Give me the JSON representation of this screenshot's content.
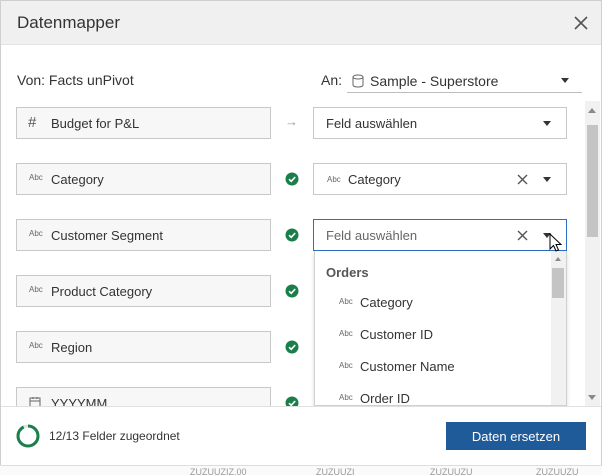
{
  "dialog": {
    "title": "Datenmapper",
    "from_label": "Von: Facts unPivot",
    "to_label": "An:",
    "to_source": "Sample - Superstore"
  },
  "rows": [
    {
      "source": "Budget for P&L",
      "source_type": "number",
      "status": "unmapped",
      "target": "Feld auswählen",
      "target_type": "none",
      "clearable": false
    },
    {
      "source": "Category",
      "source_type": "string",
      "status": "mapped",
      "target": "Category",
      "target_type": "string",
      "clearable": true
    },
    {
      "source": "Customer Segment",
      "source_type": "string",
      "status": "mapped",
      "target": "Feld auswählen",
      "target_type": "none",
      "clearable": true
    },
    {
      "source": "Product Category",
      "source_type": "string",
      "status": "mapped"
    },
    {
      "source": "Region",
      "source_type": "string",
      "status": "mapped"
    },
    {
      "source": "YYYYMM",
      "source_type": "date",
      "status": "mapped"
    }
  ],
  "type_glyphs": {
    "string": "Abc",
    "number": "#"
  },
  "dropdown": {
    "group": "Orders",
    "items": [
      {
        "label": "Category",
        "type": "Abc"
      },
      {
        "label": "Customer ID",
        "type": "Abc"
      },
      {
        "label": "Customer Name",
        "type": "Abc"
      },
      {
        "label": "Order ID",
        "type": "Abc"
      }
    ]
  },
  "footer": {
    "progress_text": "12/13 Felder zugeordnet",
    "progress_fraction": 0.923,
    "action_label": "Daten ersetzen"
  },
  "background_text": [
    "ZUZUUZIZ.00",
    "ZUZUUZI",
    "ZUZUUZU",
    "ZUZUUZU"
  ],
  "colors": {
    "accent": "#1f5b99",
    "active_border": "#2b6fc2",
    "mapped_check": "#1a7f4a",
    "progress_ring": "#1a7f4a"
  }
}
